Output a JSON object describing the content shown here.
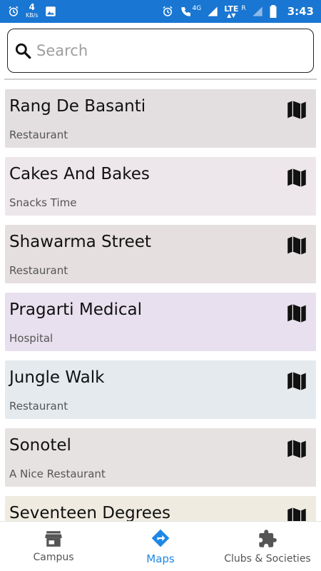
{
  "status_bar": {
    "kbs_value": "4",
    "kbs_unit": "KB/s",
    "network_4g": "4G",
    "lte": "LTE",
    "roaming": "R",
    "time": "3:43",
    "icons": [
      "alarm-icon",
      "image-icon",
      "alarm-icon",
      "call-wifi-icon",
      "signal-icon",
      "battery-icon"
    ]
  },
  "search": {
    "placeholder": "Search",
    "value": ""
  },
  "places": [
    {
      "name": "Rang De Basanti",
      "category": "Restaurant",
      "bg": "#e3dfe0"
    },
    {
      "name": "Cakes And Bakes",
      "category": "Snacks Time",
      "bg": "#ede6ea"
    },
    {
      "name": "Shawarma Street",
      "category": "Restaurant",
      "bg": "#e6dfdf"
    },
    {
      "name": "Pragarti Medical",
      "category": "Hospital",
      "bg": "#e8e0ee"
    },
    {
      "name": "Jungle Walk",
      "category": "Restaurant",
      "bg": "#e4eaee"
    },
    {
      "name": "Sonotel",
      "category": "A Nice Restaurant",
      "bg": "#e7e2e2"
    },
    {
      "name": "Seventeen Degrees",
      "category": "",
      "bg": "#efebe1"
    }
  ],
  "bottom_nav": {
    "items": [
      {
        "label": "Campus",
        "icon": "store-icon",
        "active": false
      },
      {
        "label": "Maps",
        "icon": "directions-icon",
        "active": true
      },
      {
        "label": "Clubs & Societies",
        "icon": "puzzle-icon",
        "active": false
      }
    ],
    "active_color": "#1e88e5",
    "inactive_color": "#555555"
  },
  "colors": {
    "status_bar": "#1976D2"
  }
}
